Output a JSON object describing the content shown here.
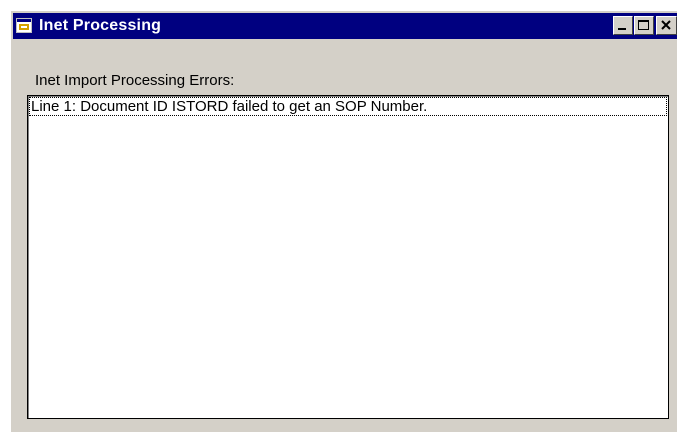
{
  "window": {
    "title": "Inet Processing",
    "icon": "app-window-icon",
    "controls": {
      "minimize_icon": "minimize-icon",
      "maximize_icon": "maximize-icon",
      "close_icon": "close-icon"
    }
  },
  "main": {
    "list_label": "Inet Import Processing Errors:",
    "errors": [
      "Line 1: Document ID ISTORD failed to get an SOP Number."
    ]
  },
  "colors": {
    "titlebar": "#000080",
    "face": "#d4d0c8",
    "list_background": "#ffffff"
  }
}
